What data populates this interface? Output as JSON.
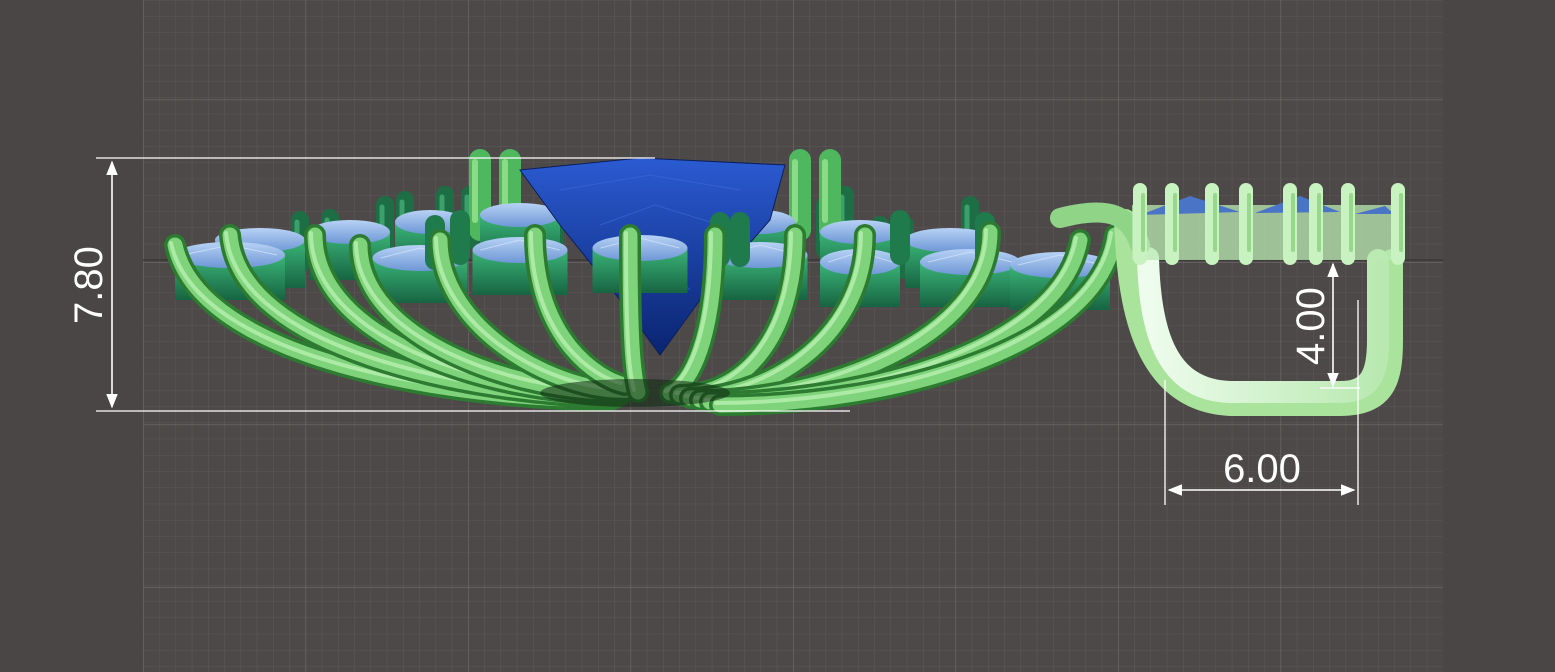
{
  "viewport": {
    "background": "#4a4645",
    "grid_area_color": "#4d4948",
    "grid_minor_color": "#5c5857",
    "grid_major_color": "#6a6665"
  },
  "colors": {
    "prong_light": "#8fe08a",
    "prong_dark": "#0f3a14",
    "setting_green": "#2f9a63",
    "setting_dark": "#1d6e45",
    "stone_light": "#8eb6ec",
    "stone_center": "#1a3aa0",
    "bail_light": "#d6f7cf",
    "dimension_line": "#ffffff"
  },
  "dimensions": {
    "height": {
      "label": "7.80"
    },
    "bail_height": {
      "label": "4.00"
    },
    "bail_width": {
      "label": "6.00"
    }
  }
}
